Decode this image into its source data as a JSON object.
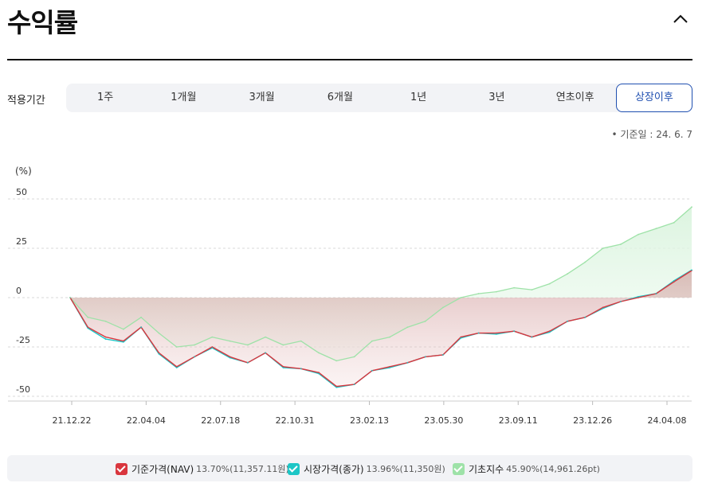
{
  "header": {
    "title": "수익률"
  },
  "period": {
    "label": "적용기간",
    "tabs": [
      "1주",
      "1개월",
      "3개월",
      "6개월",
      "1년",
      "3년",
      "연초이후",
      "상장이후"
    ],
    "active_index": 7
  },
  "base_date": "• 기준일 : 24. 6. 7",
  "unit_label": "(%)",
  "legend": [
    {
      "label": "기준가격(NAV)",
      "value": "13.70%(11,357.11원)",
      "color": "#d9363e"
    },
    {
      "label": "시장가격(종가)",
      "value": "13.96%(11,350원)",
      "color": "#1cc6c6"
    },
    {
      "label": "기초지수",
      "value": "45.90%(14,961.26pt)",
      "color": "#9ee2a8"
    }
  ],
  "chart_data": {
    "type": "area",
    "ylabel": "(%)",
    "ylim": [
      -50,
      50
    ],
    "yticks": [
      50,
      25,
      0,
      -25,
      -50
    ],
    "x_ticks": [
      "21.12.22",
      "22.04.04",
      "22.07.18",
      "22.10.31",
      "23.02.13",
      "23.05.30",
      "23.09.11",
      "23.12.26",
      "24.04.08"
    ],
    "grid": "horizontal dashed",
    "series": [
      {
        "name": "기준가격(NAV)",
        "color": "#d9363e",
        "x": [
          "21.12.22",
          "22.01.15",
          "22.02.10",
          "22.03.05",
          "22.04.04",
          "22.05.01",
          "22.06.01",
          "22.07.01",
          "22.07.18",
          "22.08.15",
          "22.09.10",
          "22.10.05",
          "22.10.31",
          "22.11.20",
          "22.12.15",
          "23.01.05",
          "23.01.25",
          "23.02.13",
          "23.03.10",
          "23.04.05",
          "23.05.01",
          "23.05.30",
          "23.06.20",
          "23.07.15",
          "23.08.10",
          "23.09.11",
          "23.10.10",
          "23.11.01",
          "23.11.25",
          "23.12.26",
          "24.01.20",
          "24.02.15",
          "24.03.10",
          "24.04.08",
          "24.05.05",
          "24.06.07"
        ],
        "y": [
          0,
          -15,
          -20,
          -22,
          -15,
          -28,
          -35,
          -30,
          -25,
          -30,
          -33,
          -28,
          -35,
          -36,
          -38,
          -45,
          -44,
          -37,
          -35,
          -33,
          -30,
          -29,
          -20,
          -18,
          -18,
          -17,
          -20,
          -17,
          -12,
          -10,
          -5,
          -2,
          0,
          2,
          8,
          13.7
        ]
      },
      {
        "name": "시장가격(종가)",
        "color": "#1cc6c6",
        "x": [
          "21.12.22",
          "22.01.15",
          "22.02.10",
          "22.03.05",
          "22.04.04",
          "22.05.01",
          "22.06.01",
          "22.07.01",
          "22.07.18",
          "22.08.15",
          "22.09.10",
          "22.10.05",
          "22.10.31",
          "22.11.20",
          "22.12.15",
          "23.01.05",
          "23.01.25",
          "23.02.13",
          "23.03.10",
          "23.04.05",
          "23.05.01",
          "23.05.30",
          "23.06.20",
          "23.07.15",
          "23.08.10",
          "23.09.11",
          "23.10.10",
          "23.11.01",
          "23.11.25",
          "23.12.26",
          "24.01.20",
          "24.02.15",
          "24.03.10",
          "24.04.08",
          "24.05.05",
          "24.06.07"
        ],
        "y": [
          0,
          -15.5,
          -21,
          -22.5,
          -15,
          -28.5,
          -35.5,
          -30,
          -25.5,
          -30.5,
          -33,
          -28,
          -35.5,
          -36,
          -38.5,
          -45.5,
          -44,
          -37,
          -35.5,
          -33,
          -30,
          -29,
          -20.5,
          -18,
          -18.5,
          -17,
          -20,
          -17.5,
          -12,
          -10,
          -5.5,
          -2,
          0.5,
          2,
          8.5,
          13.96
        ]
      },
      {
        "name": "기초지수",
        "color": "#9ee2a8",
        "x": [
          "21.12.22",
          "22.01.15",
          "22.02.10",
          "22.03.05",
          "22.04.04",
          "22.05.01",
          "22.06.01",
          "22.07.01",
          "22.07.18",
          "22.08.15",
          "22.09.10",
          "22.10.05",
          "22.10.31",
          "22.11.20",
          "22.12.15",
          "23.01.05",
          "23.01.25",
          "23.02.13",
          "23.03.10",
          "23.04.05",
          "23.05.01",
          "23.05.30",
          "23.06.20",
          "23.07.15",
          "23.08.10",
          "23.09.11",
          "23.10.10",
          "23.11.01",
          "23.11.25",
          "23.12.26",
          "24.01.20",
          "24.02.15",
          "24.03.10",
          "24.04.08",
          "24.05.05",
          "24.06.07"
        ],
        "y": [
          0,
          -10,
          -12,
          -16,
          -10,
          -18,
          -25,
          -24,
          -20,
          -22,
          -24,
          -20,
          -24,
          -22,
          -28,
          -32,
          -30,
          -22,
          -20,
          -15,
          -12,
          -5,
          0,
          2,
          3,
          5,
          4,
          7,
          12,
          18,
          25,
          27,
          32,
          35,
          38,
          45.9
        ]
      }
    ]
  }
}
